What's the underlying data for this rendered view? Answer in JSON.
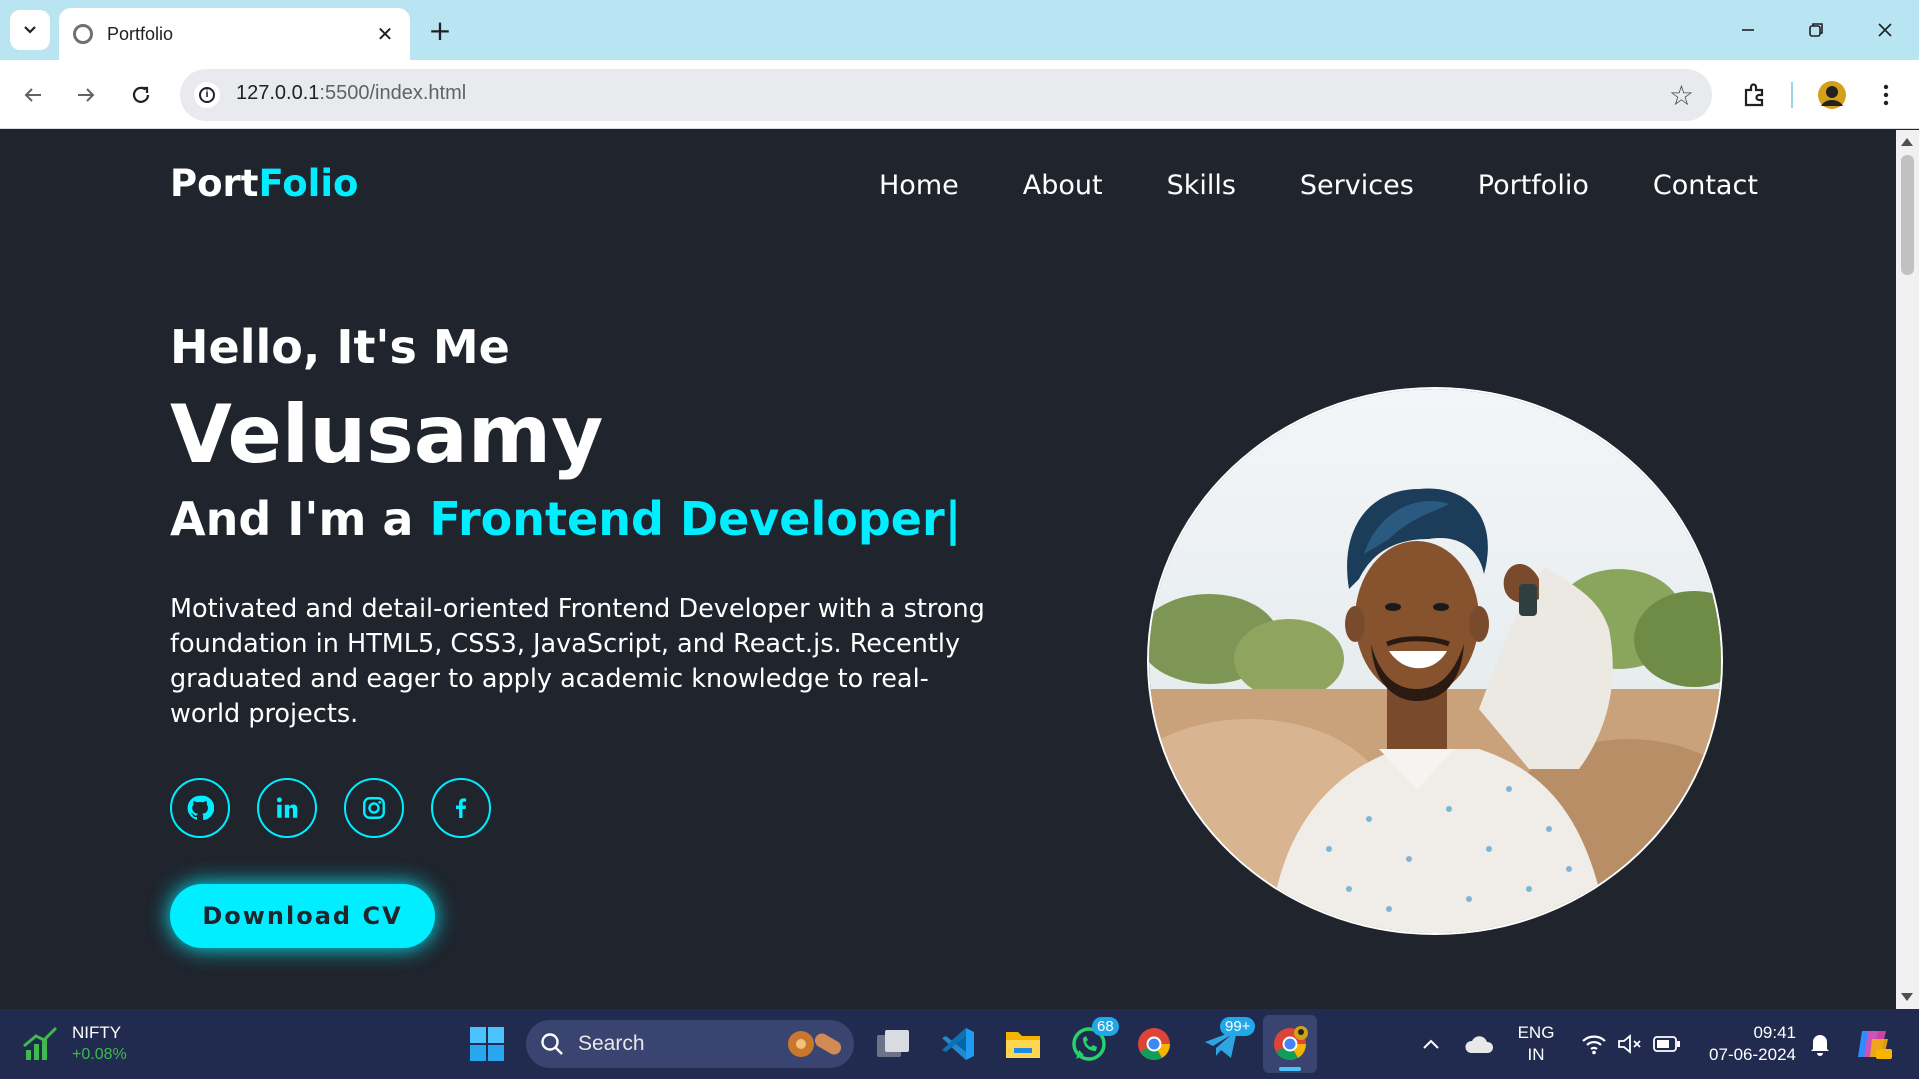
{
  "browser": {
    "tab_title": "Portfolio",
    "url_host": "127.0.0.1",
    "url_path": ":5500/index.html"
  },
  "site": {
    "logo_main": "Port",
    "logo_accent": "Folio",
    "nav": [
      "Home",
      "About",
      "Skills",
      "Services",
      "Portfolio",
      "Contact"
    ],
    "greeting": "Hello, It's Me",
    "name": "Velusamy",
    "role_prefix": "And I'm a ",
    "role_highlight": "Frontend Developer|",
    "description": "Motivated and detail-oriented Frontend Developer with a strong foundation in HTML5, CSS3, JavaScript, and React.js. Recently graduated and eager to apply academic knowledge to real-world projects.",
    "socials": [
      "github-icon",
      "linkedin-icon",
      "instagram-icon",
      "facebook-icon"
    ],
    "cv_button": "Download CV",
    "accent_color": "#00eeff",
    "bg_color": "#1f242d"
  },
  "taskbar": {
    "stock_name": "NIFTY",
    "stock_change": "+0.08%",
    "search_label": "Search",
    "whatsapp_badge": "68",
    "telegram_badge": "99+",
    "lang_top": "ENG",
    "lang_bottom": "IN",
    "time": "09:41",
    "date": "07-06-2024"
  }
}
